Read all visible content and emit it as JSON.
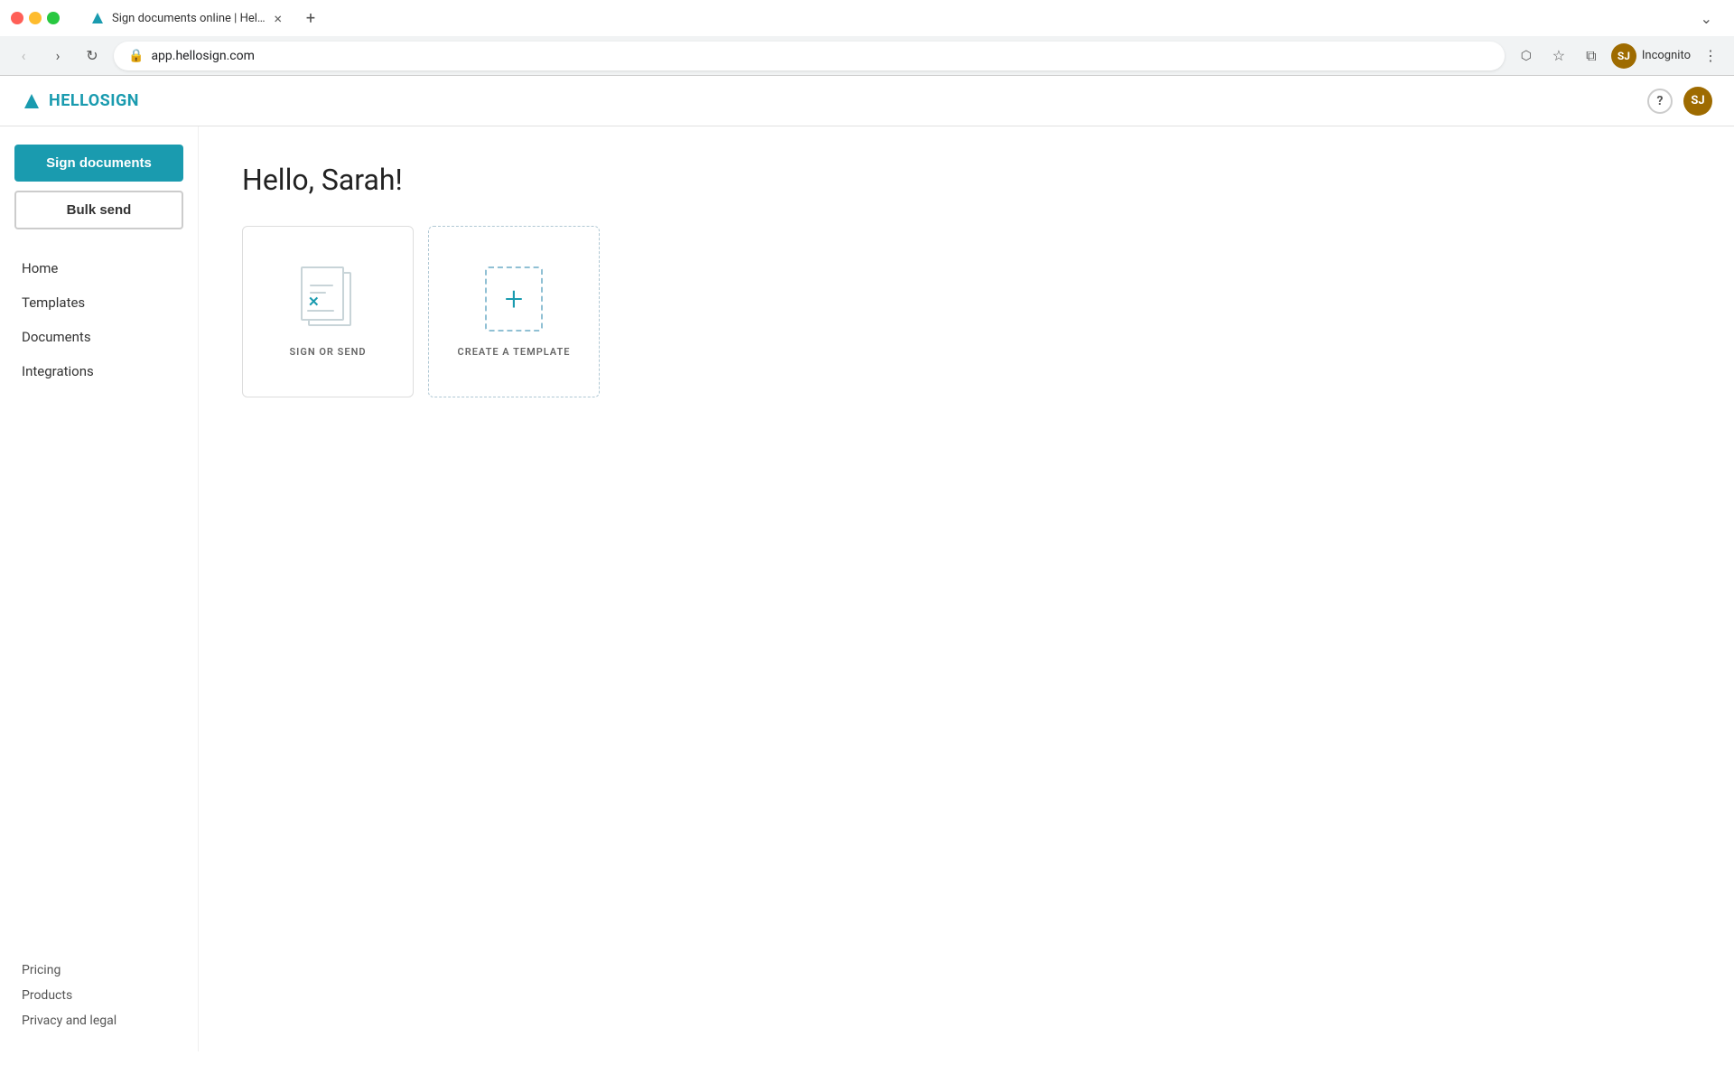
{
  "browser": {
    "tab_title": "Sign documents online | HelloS...",
    "tab_close": "×",
    "new_tab": "+",
    "nav_back": "‹",
    "nav_forward": "›",
    "nav_refresh": "↻",
    "address_url": "app.hellosign.com",
    "incognito_text": "Incognito",
    "user_initials": "SJ",
    "more_menu": "⋮",
    "extend_btn": "⤢"
  },
  "app": {
    "logo_text": "HELLOSIGN",
    "help_label": "?",
    "avatar_initials": "SJ"
  },
  "sidebar": {
    "sign_docs_label": "Sign documents",
    "bulk_send_label": "Bulk send",
    "nav_items": [
      {
        "label": "Home",
        "id": "home"
      },
      {
        "label": "Templates",
        "id": "templates"
      },
      {
        "label": "Documents",
        "id": "documents"
      },
      {
        "label": "Integrations",
        "id": "integrations"
      }
    ],
    "footer_links": [
      {
        "label": "Pricing"
      },
      {
        "label": "Products"
      },
      {
        "label": "Privacy and legal"
      }
    ]
  },
  "main": {
    "greeting": "Hello, Sarah!",
    "card_sign_or_send": "SIGN OR SEND",
    "card_create_template": "CREATE A TEMPLATE"
  }
}
